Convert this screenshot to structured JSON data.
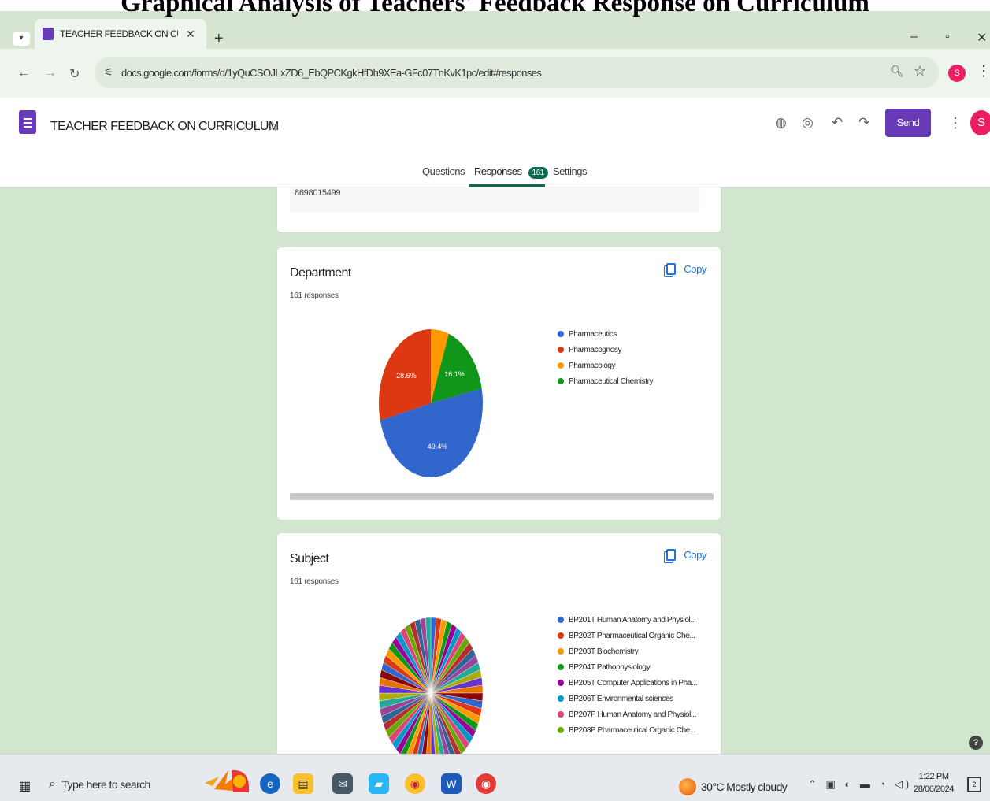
{
  "document_heading": "Graphical Analysis of Teachers' Feedback Response on Curriculum",
  "browser": {
    "tab_title": "TEACHER FEEDBACK ON CURR",
    "url": "docs.google.com/forms/d/1yQuCSOJLxZD6_EbQPCKgkHfDh9XEa-GFc07TnKvK1pc/edit#responses",
    "profile_initial": "S",
    "window_controls": [
      "–",
      "▫",
      "X"
    ]
  },
  "forms": {
    "title": "TEACHER FEEDBACK ON CURRICULUM",
    "send_label": "Send",
    "avatar_initial": "S",
    "tabs": {
      "questions": "Questions",
      "responses": "Responses",
      "responses_count": "161",
      "settings": "Settings"
    }
  },
  "previous_card": {
    "answer": "8698015499"
  },
  "department_card": {
    "title": "Department",
    "responses": "161 responses",
    "copy_label": "Copy",
    "chart_data": {
      "type": "pie",
      "categories": [
        "Pharmaceutics",
        "Pharmacognosy",
        "Pharmacology",
        "Pharmaceutical Chemistry"
      ],
      "values": [
        49.4,
        28.6,
        5.6,
        16.1
      ],
      "value_labels": [
        "49.4%",
        "28.6%",
        "",
        "16.1%"
      ],
      "colors": [
        "#3366cc",
        "#dc3912",
        "#ff9900",
        "#109618"
      ],
      "legend_position": "right"
    }
  },
  "subject_card": {
    "title": "Subject",
    "responses": "161 responses",
    "copy_label": "Copy",
    "legend": [
      {
        "label": "BP201T Human Anatomy and Physiol...",
        "color": "#3366cc"
      },
      {
        "label": "BP202T Pharmaceutical Organic Che...",
        "color": "#dc3912"
      },
      {
        "label": "BP203T Biochemistry",
        "color": "#ff9900"
      },
      {
        "label": "BP204T Pathophysiology",
        "color": "#109618"
      },
      {
        "label": "BP205T Computer Applications in Pha...",
        "color": "#990099"
      },
      {
        "label": "BP206T Environmental sciences",
        "color": "#0099c6"
      },
      {
        "label": "BP207P Human Anatomy and Physiol...",
        "color": "#dd4477"
      },
      {
        "label": "BP208P Pharmaceutical Organic Che...",
        "color": "#66aa00"
      }
    ]
  },
  "taskbar": {
    "search_placeholder": "Type here to search",
    "weather": "30°C  Mostly cloudy",
    "time": "1:22 PM",
    "date": "28/06/2024",
    "notification_count": "2"
  }
}
